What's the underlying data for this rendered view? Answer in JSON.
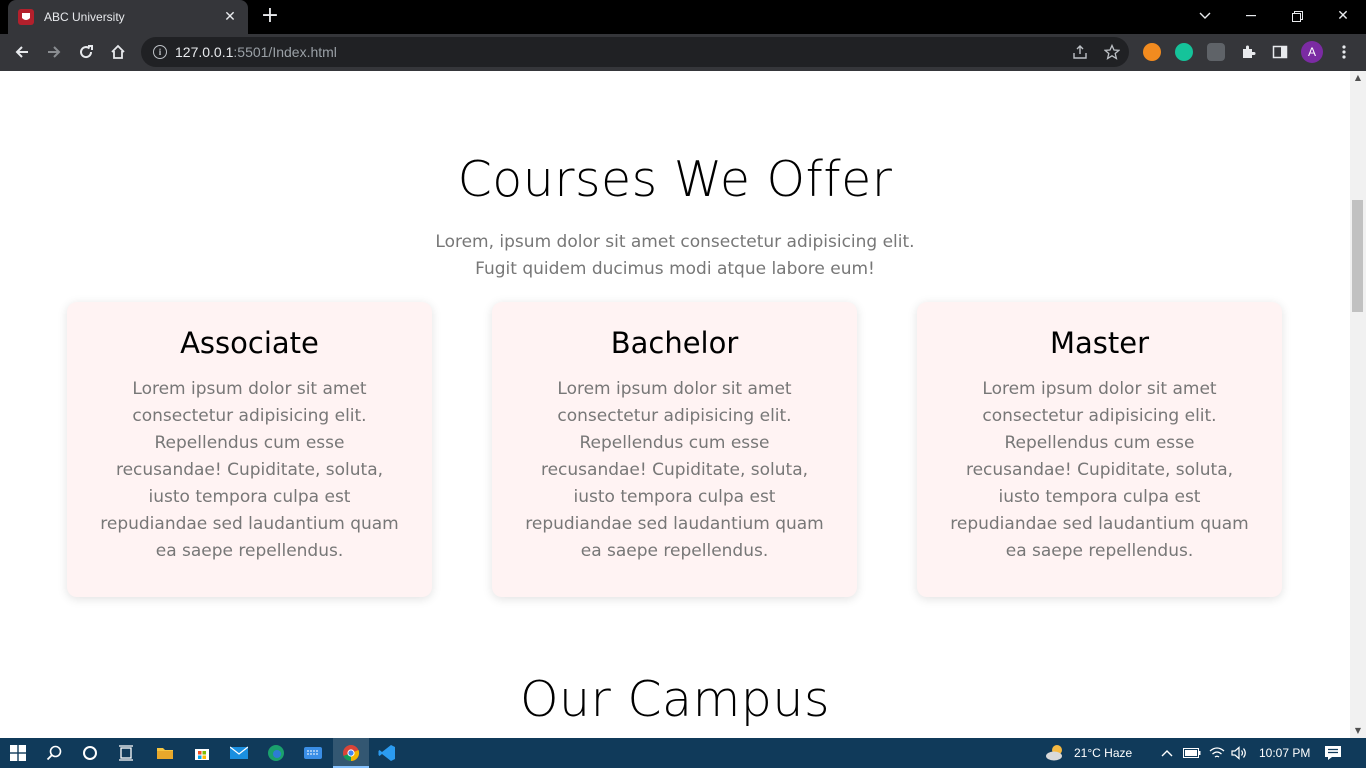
{
  "browser": {
    "tab_title": "ABC University",
    "url_host": "127.0.0.1",
    "url_path": ":5501/Index.html",
    "avatar_letter": "A"
  },
  "page": {
    "courses_title": "Courses We Offer",
    "courses_subtitle_line1": "Lorem, ipsum dolor sit amet consectetur adipisicing elit.",
    "courses_subtitle_line2": "Fugit quidem ducimus modi atque labore eum!",
    "cards": [
      {
        "title": "Associate",
        "text": "Lorem ipsum dolor sit amet consectetur adipisicing elit. Repellendus cum esse recusandae! Cupiditate, soluta, iusto tempora culpa est repudiandae sed laudantium quam ea saepe repellendus."
      },
      {
        "title": "Bachelor",
        "text": "Lorem ipsum dolor sit amet consectetur adipisicing elit. Repellendus cum esse recusandae! Cupiditate, soluta, iusto tempora culpa est repudiandae sed laudantium quam ea saepe repellendus."
      },
      {
        "title": "Master",
        "text": "Lorem ipsum dolor sit amet consectetur adipisicing elit. Repellendus cum esse recusandae! Cupiditate, soluta, iusto tempora culpa est repudiandae sed laudantium quam ea saepe repellendus."
      }
    ],
    "campus_title": "Our Campus"
  },
  "taskbar": {
    "weather": "21°C  Haze",
    "time": "10:07 PM"
  },
  "colors": {
    "card_bg": "#fff3f3",
    "taskbar_bg": "#103a5a",
    "chrome_toolbar": "#35363a"
  }
}
